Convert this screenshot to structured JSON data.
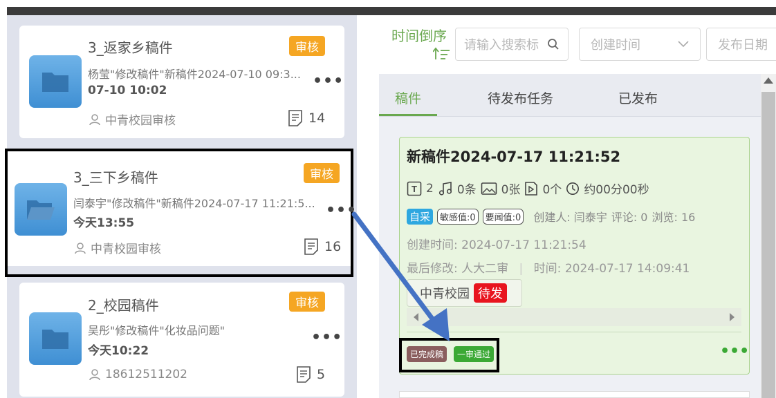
{
  "cards": [
    {
      "title": "3_返家乡稿件",
      "badge": "审核",
      "desc": "杨莹\"修改稿件\"新稿件2024-07-10 09:3...",
      "time": "07-10 10:02",
      "owner": "中青校园审核",
      "count": "14",
      "more": "•••"
    },
    {
      "title": "3_三下乡稿件",
      "badge": "审核",
      "desc": "闫泰宇\"修改稿件\"新稿件2024-07-17 11:21:5...",
      "time": "今天13:55",
      "owner": "中青校园审核",
      "count": "16",
      "more": "•••"
    },
    {
      "title": "2_校园稿件",
      "badge": "审核",
      "desc": "吴彤\"修改稿件\"化妆品问题\"",
      "time": "今天10:22",
      "owner": "18612511202",
      "count": "5",
      "more": "•••"
    }
  ],
  "toolbar": {
    "sort_label": "时间倒序",
    "search_placeholder": "请输入搜索标",
    "created_time": "创建时间",
    "publish_date": "发布日期"
  },
  "tabs": [
    "稿件",
    "待发布任务",
    "已发布"
  ],
  "detail": {
    "title": "新稿件2024-07-17 11:21:52",
    "text_count": "2",
    "audio_count": "0条",
    "image_count": "0张",
    "video_count": "0个",
    "duration": "约00分00秒",
    "tag_source": "自采",
    "tag_sensitive": "敏感值:0",
    "tag_news": "要闻值:0",
    "creator": "创建人: 闫泰宇",
    "comments": "评论: 0",
    "views": "浏览: 16",
    "created_at": "创建时间: 2024-07-17 11:21:54",
    "last_modified_by": "最后修改: 人大二审",
    "modified_at": "时间: 2024-07-17 14:09:41",
    "org": "中青校园",
    "org_status": "待发",
    "status_done": "已完成稿",
    "status_pass": "一审通过",
    "more": "•••"
  },
  "colors": {
    "accent_green": "#6aa84f",
    "badge_orange": "#f5a623",
    "arrow_blue": "#4472c4",
    "status_red": "#e8141e"
  }
}
